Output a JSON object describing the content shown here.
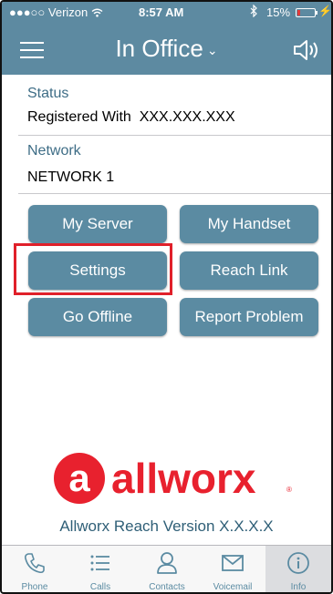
{
  "status_bar": {
    "signal": "●●●○○",
    "carrier": "Verizon",
    "time": "8:57 AM",
    "battery": "15%",
    "battery_level": 0.15
  },
  "header": {
    "title": "In Office",
    "menu_icon": "hamburger-menu-icon",
    "speaker_icon": "speaker-icon"
  },
  "info": {
    "status_label": "Status",
    "status_value": "Registered With  XXX.XXX.XXX",
    "network_label": "Network",
    "network_value": "NETWORK 1"
  },
  "buttons": {
    "my_server": "My Server",
    "my_handset": "My Handset",
    "settings": "Settings",
    "reach_link": "Reach Link",
    "go_offline": "Go Offline",
    "report_problem": "Report Problem"
  },
  "branding": {
    "logo_text": "allworx",
    "version": "Allworx Reach Version X.X.X.X"
  },
  "tabs": [
    {
      "label": "Phone",
      "icon": "phone-icon"
    },
    {
      "label": "Calls",
      "icon": "list-icon"
    },
    {
      "label": "Contacts",
      "icon": "person-icon"
    },
    {
      "label": "Voicemail",
      "icon": "envelope-icon"
    },
    {
      "label": "Info",
      "icon": "info-icon"
    }
  ],
  "colors": {
    "header_bg": "#5d8aa1",
    "button_bg": "#5b8ba2",
    "highlight": "#e0202a",
    "logo_red": "#e8212e"
  }
}
